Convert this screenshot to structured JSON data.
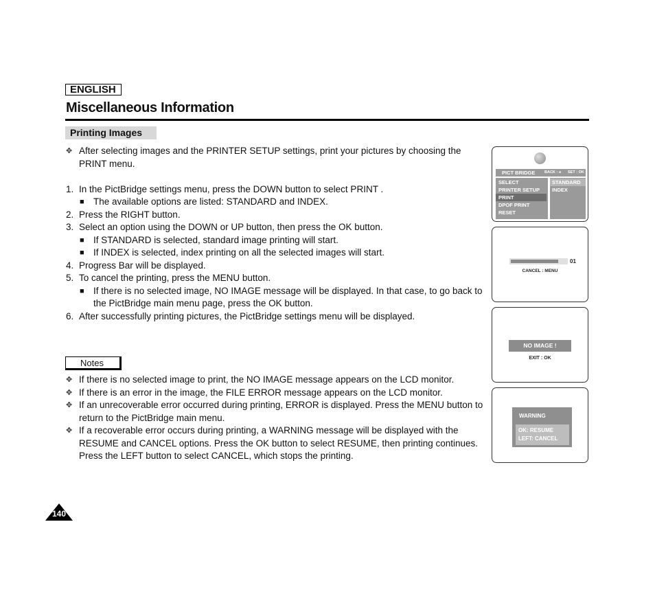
{
  "header": {
    "language": "ENGLISH",
    "title": "Miscellaneous Information",
    "section": "Printing Images"
  },
  "intro": "After selecting images and the PRINTER SETUP settings, print your pictures by choosing the PRINT menu.",
  "steps": [
    {
      "num": "1.",
      "text": "In the PictBridge settings menu, press the DOWN button to select  PRINT ."
    },
    {
      "sub": "The available options are listed: STANDARD and INDEX."
    },
    {
      "num": "2.",
      "text": "Press the RIGHT button."
    },
    {
      "num": "3.",
      "text": "Select an option using the DOWN or UP button, then press the OK button."
    },
    {
      "sub": "If  STANDARD  is selected, standard image printing will start."
    },
    {
      "sub": "If  INDEX  is selected, index printing on all the selected images will start."
    },
    {
      "num": "4.",
      "text": "Progress Bar will be displayed."
    },
    {
      "num": "5.",
      "text": "To cancel the printing, press the MENU button."
    },
    {
      "sub": "If there is no selected image,  NO IMAGE  message will be displayed. In that case, to go back to the PictBridge main menu page, press the OK button."
    },
    {
      "num": "6.",
      "text": "After successfully printing pictures, the PictBridge settings menu will be displayed."
    }
  ],
  "notes": {
    "label": "Notes",
    "items": [
      "If there is no selected image to print, the  NO IMAGE  message appears on the LCD monitor.",
      "If there is an error in the image, the  FILE ERROR  message appears on the LCD monitor.",
      "If an unrecoverable error occurred during printing,  ERROR  is displayed. Press the MENU button to return to the PictBridge main menu.",
      "If a recoverable error occurs during printing, a  WARNING  message will be displayed with the RESUME and CANCEL options. Press the OK button to select RESUME, then printing continues. Press the LEFT button to select CANCEL, which stops the printing."
    ]
  },
  "page_number": "140",
  "screens": {
    "pictbridge": {
      "title": "PICT BRIDGE",
      "back_hint": "BACK : ◂",
      "set_hint": "SET : OK",
      "menu": [
        "SELECT",
        "PRINTER SETUP",
        "PRINT",
        "DPOF PRINT",
        "RESET"
      ],
      "selected_menu": "PRINT",
      "options": [
        "STANDARD",
        "INDEX"
      ],
      "selected_option": "STANDARD"
    },
    "progress": {
      "progress_fraction": 0.85,
      "count": "01",
      "cancel_hint": "CANCEL : MENU"
    },
    "no_image": {
      "message": "NO IMAGE !",
      "exit_hint": "EXIT : OK"
    },
    "warning": {
      "title": "WARNING",
      "resume": "OK: RESUME",
      "cancel": "LEFT: CANCEL"
    }
  }
}
